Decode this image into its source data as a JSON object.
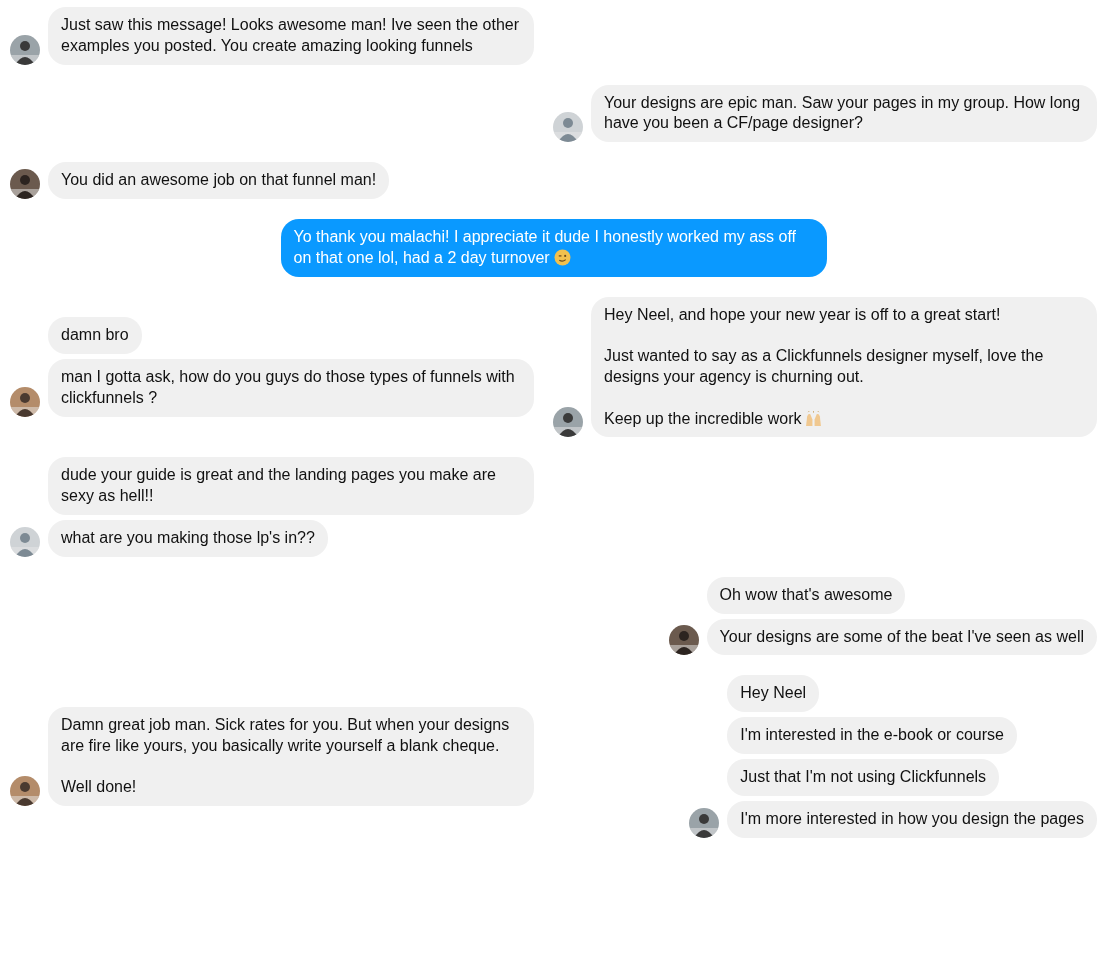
{
  "rows": [
    {
      "groups": [
        {
          "kind": "left",
          "avatar": {
            "kind": "picture"
          },
          "messages": [
            {
              "kind": "text",
              "text": "Just saw this message! Looks awesome man! Ive seen the other examples you posted. You create amazing looking funnels"
            }
          ]
        }
      ]
    },
    {
      "groups": [
        {
          "kind": "right",
          "avatar": {
            "kind": "picture"
          },
          "messages": [
            {
              "kind": "text",
              "text": "Your designs are epic man. Saw your pages in my group. How long have you been a CF/page designer?"
            }
          ]
        }
      ]
    },
    {
      "groups": [
        {
          "kind": "left",
          "avatar": {
            "kind": "picture"
          },
          "messages": [
            {
              "kind": "text",
              "text": "You did an awesome job on that funnel man!"
            }
          ]
        }
      ]
    },
    {
      "groups": [
        {
          "kind": "outgoing",
          "messages": [
            {
              "kind": "text-face",
              "text": "Yo thank you malachi! I appreciate it dude I honestly worked my ass off on that one lol, had a 2 day turnover"
            }
          ]
        }
      ]
    },
    {
      "groups": [
        {
          "kind": "left",
          "avatar": {
            "kind": "picture"
          },
          "messages": [
            {
              "kind": "text",
              "text": "damn bro"
            },
            {
              "kind": "text",
              "text": "man I gotta ask, how do you guys do those types of funnels with clickfunnels ?"
            }
          ]
        },
        {
          "kind": "right",
          "avatar": {
            "kind": "picture"
          },
          "messages": [
            {
              "kind": "text-hands",
              "text": "Hey Neel, and hope your new year is off to a great start!\n\nJust wanted to say as a Clickfunnels designer myself, love the designs your agency is churning out.\n\nKeep up the incredible work"
            }
          ]
        }
      ]
    },
    {
      "groups": [
        {
          "kind": "left",
          "avatar": {
            "kind": "picture"
          },
          "messages": [
            {
              "kind": "text",
              "text": "dude your guide is great and the landing pages you make are sexy as hell!!"
            },
            {
              "kind": "text",
              "text": "what are you making those lp's in??"
            }
          ]
        }
      ]
    },
    {
      "groups": [
        {
          "kind": "right",
          "avatar": {
            "kind": "picture"
          },
          "messages": [
            {
              "kind": "text",
              "text": "Oh wow that's awesome"
            },
            {
              "kind": "text",
              "text": "Your designs are some of the beat I've seen as well"
            }
          ]
        }
      ]
    },
    {
      "groups": [
        {
          "kind": "left",
          "avatar": {
            "kind": "picture"
          },
          "messages": [
            {
              "kind": "text",
              "text": "Damn great job man. Sick rates for you. But when your designs are fire like yours, you basically write yourself a blank cheque.\n\nWell done!"
            }
          ]
        },
        {
          "kind": "right",
          "avatar": {
            "kind": "picture"
          },
          "messages": [
            {
              "kind": "text",
              "text": "Hey Neel"
            },
            {
              "kind": "text",
              "text": "I'm interested in the e-book or course"
            },
            {
              "kind": "text",
              "text": "Just that I'm not using Clickfunnels"
            },
            {
              "kind": "text",
              "text": "I'm more interested in how you design the pages"
            }
          ]
        }
      ]
    }
  ]
}
